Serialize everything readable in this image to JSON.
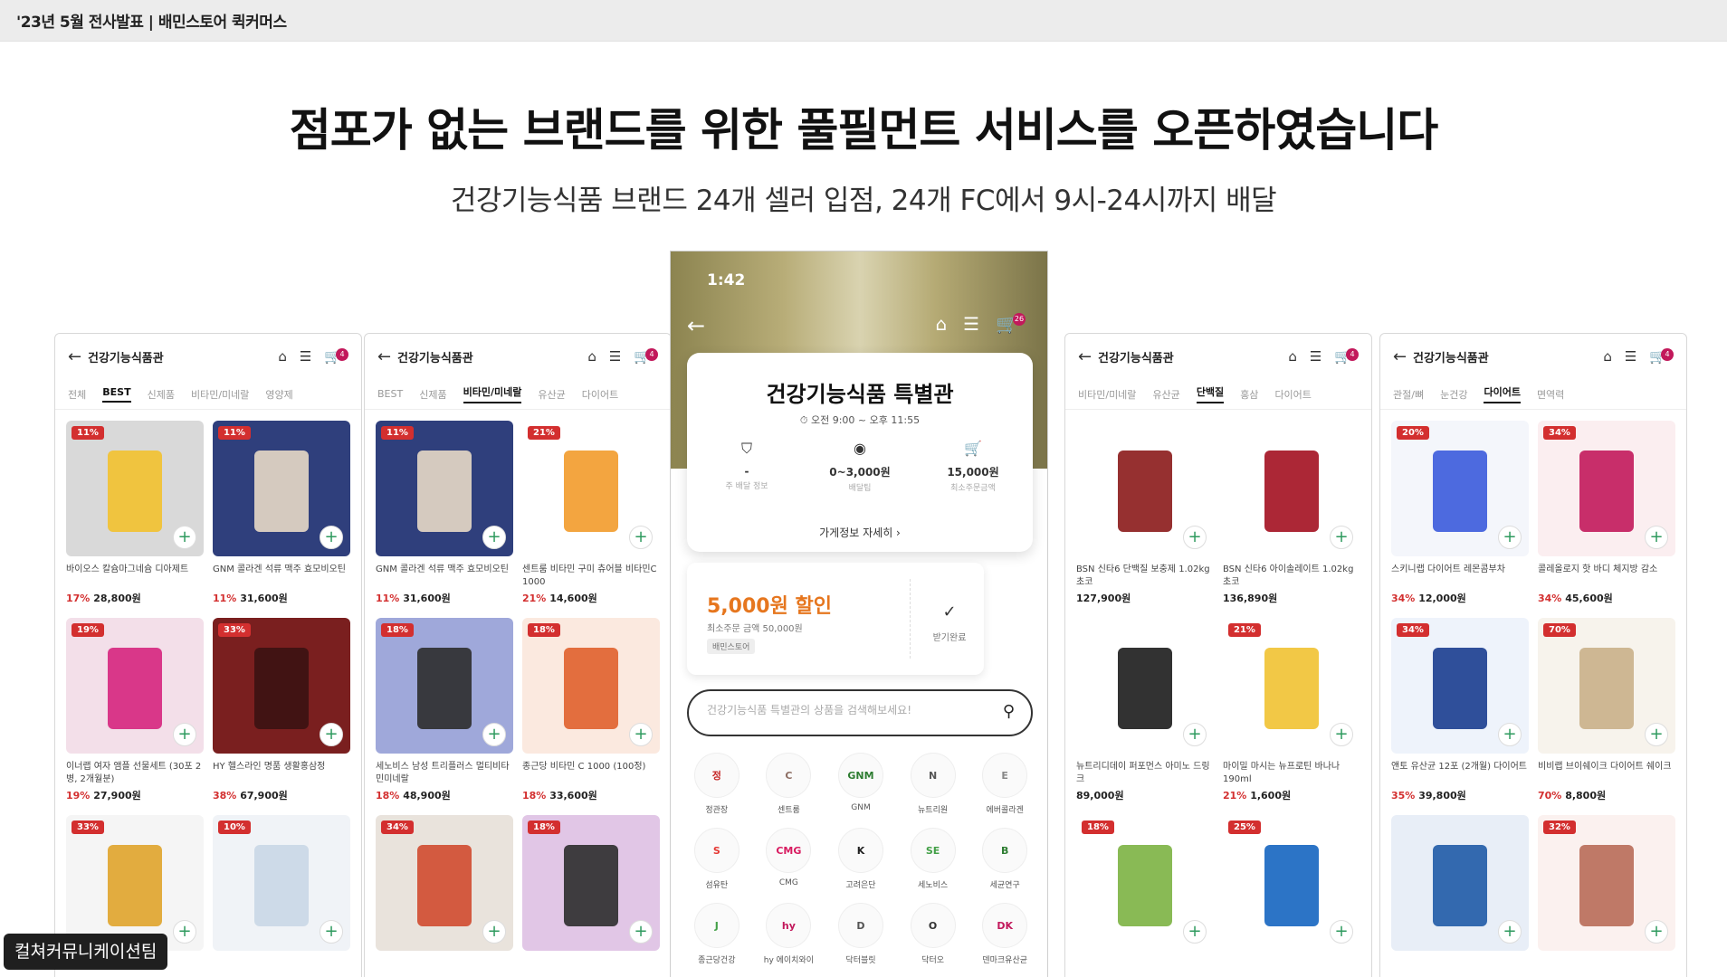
{
  "topbar": {
    "title": "'23년 5월 전사발표 | 배민스토어 퀵커머스"
  },
  "slide": {
    "headline": "점포가 없는 브랜드를 위한 풀필먼트 서비스를 오픈하였습니다",
    "subline": "건강기능식품 브랜드 24개 셀러 입점, 24개 FC에서 9시-24시까지 배달"
  },
  "center_phone": {
    "status_time": "1:42",
    "cart_count": "26",
    "title": "건강기능식품 특별관",
    "hours": "오전 9:00 ~ 오후 11:55",
    "stats": [
      {
        "icon": "shield-icon",
        "value": "-",
        "label": "주 배달 정보"
      },
      {
        "icon": "coin-icon",
        "value": "0~3,000원",
        "label": "배달팁"
      },
      {
        "icon": "cart-icon",
        "value": "15,000원",
        "label": "최소주문금액"
      }
    ],
    "more_link": "가게정보 자세히 ›",
    "coupon": {
      "amount": "5,000원 할인",
      "condition": "최소주문 금액 50,000원",
      "tag": "배민스토어",
      "action": "받기완료"
    },
    "search_placeholder": "건강기능식품 특별관의 상품을 검색해보세요!",
    "brands": [
      {
        "name": "정관장",
        "logo": "정",
        "color": "#c62828"
      },
      {
        "name": "센트룸",
        "logo": "C",
        "color": "#8d6e63"
      },
      {
        "name": "GNM",
        "logo": "GNM",
        "color": "#2e7d32"
      },
      {
        "name": "뉴트리원",
        "logo": "N",
        "color": "#555555"
      },
      {
        "name": "에버콜라겐",
        "logo": "E",
        "color": "#888888"
      },
      {
        "name": "섬유탄",
        "logo": "S",
        "color": "#e53935"
      },
      {
        "name": "CMG",
        "logo": "CMG",
        "color": "#d81b60"
      },
      {
        "name": "고려은단",
        "logo": "K",
        "color": "#222222"
      },
      {
        "name": "세노비스",
        "logo": "SE",
        "color": "#43a047"
      },
      {
        "name": "세균연구",
        "logo": "B",
        "color": "#2e7d32"
      },
      {
        "name": "종근당건강",
        "logo": "J",
        "color": "#43a047"
      },
      {
        "name": "hy 에이치와이",
        "logo": "hy",
        "color": "#c2185b"
      },
      {
        "name": "닥터블릿",
        "logo": "D",
        "color": "#555555"
      },
      {
        "name": "닥터오",
        "logo": "O",
        "color": "#333333"
      },
      {
        "name": "덴마크유산균",
        "logo": "DK",
        "color": "#c2185b"
      }
    ]
  },
  "panels": [
    {
      "title": "건강기능식품관",
      "cart_count": "4",
      "tabs": [
        "전체",
        "BEST",
        "신제품",
        "비타민/미네랄",
        "영양제"
      ],
      "active_tab": 1,
      "products": [
        {
          "discount": "11%",
          "name": "바이오스 칼슘마그네슘 디아제트",
          "price_pct": "17%",
          "price": "28,800원",
          "color": "#d9d9d9",
          "accent": "#f2c12e"
        },
        {
          "discount": "11%",
          "name": "GNM 콜라겐 석류 맥주 효모비오틴",
          "price_pct": "11%",
          "price": "31,600원",
          "color": "#2f3f7c",
          "accent": "#e8d9c6"
        },
        {
          "discount": "19%",
          "name": "이너랩 여자 앰플 선물세트 (30포 2병, 2개월분)",
          "price_pct": "19%",
          "price": "27,900원",
          "color": "#f3dfe9",
          "accent": "#d6257e"
        },
        {
          "discount": "33%",
          "name": "HY 헬스라인 명품 생활홍삼정",
          "price_pct": "38%",
          "price": "67,900원",
          "color": "#7a1f1f",
          "accent": "#3b1212"
        },
        {
          "discount": "33%",
          "name": "",
          "price_pct": "",
          "price": "",
          "color": "#f5f5f5",
          "accent": "#e0a42b"
        },
        {
          "discount": "10%",
          "name": "",
          "price_pct": "",
          "price": "",
          "color": "#f0f3f7",
          "accent": "#c9d7e6"
        }
      ]
    },
    {
      "title": "건강기능식품관",
      "cart_count": "4",
      "tabs": [
        "BEST",
        "신제품",
        "비타민/미네랄",
        "유산균",
        "다이어트"
      ],
      "active_tab": 2,
      "products": [
        {
          "discount": "11%",
          "name": "GNM 콜라겐 석류 맥주 효모비오틴",
          "price_pct": "11%",
          "price": "31,600원",
          "color": "#2f3f7c",
          "accent": "#e8d9c6"
        },
        {
          "discount": "21%",
          "name": "센트룸 비타민 구미 츄어블 비타민C 1000",
          "price_pct": "21%",
          "price": "14,600원",
          "color": "#ffffff",
          "accent": "#f29b2b"
        },
        {
          "discount": "18%",
          "name": "세노비스 남성 트리플러스 멀티비타민미네랄",
          "price_pct": "18%",
          "price": "48,900원",
          "color": "#9fa8da",
          "accent": "#2c2c2c"
        },
        {
          "discount": "18%",
          "name": "종근당 비타민 C 1000 (100정)",
          "price_pct": "18%",
          "price": "33,600원",
          "color": "#fbe9df",
          "accent": "#e0602c"
        },
        {
          "discount": "34%",
          "name": "",
          "price_pct": "",
          "price": "",
          "color": "#e9e3dc",
          "accent": "#d04a2f"
        },
        {
          "discount": "18%",
          "name": "",
          "price_pct": "",
          "price": "",
          "color": "#e1c6e6",
          "accent": "#2c2c2c"
        }
      ]
    },
    {
      "title": "건강기능식품관",
      "cart_count": "4",
      "tabs": [
        "비타민/미네랄",
        "유산균",
        "단백질",
        "홍삼",
        "다이어트"
      ],
      "active_tab": 2,
      "products": [
        {
          "discount": "",
          "name": "BSN 신타6 단백질 보충제 1.02kg 초코",
          "price_pct": "",
          "price": "127,900원",
          "color": "#ffffff",
          "accent": "#8b1a1a"
        },
        {
          "discount": "",
          "name": "BSN 신타6 아이솔레이트 1.02kg 초코",
          "price_pct": "",
          "price": "136,890원",
          "color": "#ffffff",
          "accent": "#a31020"
        },
        {
          "discount": "",
          "name": "뉴트리디데이 퍼포먼스 아미노 드링크",
          "price_pct": "",
          "price": "89,000원",
          "color": "#ffffff",
          "accent": "#1c1c1c"
        },
        {
          "discount": "21%",
          "name": "마이밀 마시는 뉴프로틴 바나나 190ml",
          "price_pct": "21%",
          "price": "1,600원",
          "color": "#ffffff",
          "accent": "#f1c232"
        },
        {
          "discount": "18%",
          "name": "",
          "price_pct": "",
          "price": "",
          "color": "#ffffff",
          "accent": "#7cb342"
        },
        {
          "discount": "25%",
          "name": "",
          "price_pct": "",
          "price": "",
          "color": "#ffffff",
          "accent": "#1565c0"
        }
      ]
    },
    {
      "title": "건강기능식품관",
      "cart_count": "4",
      "tabs": [
        "관절/뼈",
        "눈건강",
        "다이어트",
        "면역력"
      ],
      "active_tab": 2,
      "products": [
        {
          "discount": "20%",
          "name": "스키니랩 다이어트 레몬콤부차",
          "price_pct": "34%",
          "price": "12,000원",
          "color": "#f4f6fb",
          "accent": "#3b5bdb"
        },
        {
          "discount": "34%",
          "name": "콜레올로지 핫 바디 체지방 감소",
          "price_pct": "34%",
          "price": "45,600원",
          "color": "#fbeef0",
          "accent": "#c2185b"
        },
        {
          "discount": "34%",
          "name": "앤토 유산균 12포 (2개월) 다이어트",
          "price_pct": "35%",
          "price": "39,800원",
          "color": "#eef3fb",
          "accent": "#1a3d8f"
        },
        {
          "discount": "70%",
          "name": "비비랩 브이쉐이크 다이어트 쉐이크",
          "price_pct": "70%",
          "price": "8,800원",
          "color": "#f7f3ec",
          "accent": "#c9b08a"
        },
        {
          "discount": "",
          "name": "",
          "price_pct": "",
          "price": "",
          "color": "#e8eef7",
          "accent": "#1f5aa6"
        },
        {
          "discount": "32%",
          "name": "",
          "price_pct": "",
          "price": "",
          "color": "#fbf1ef",
          "accent": "#b86b58"
        }
      ]
    }
  ],
  "badge": {
    "text": "컬쳐커뮤니케이션팀"
  }
}
